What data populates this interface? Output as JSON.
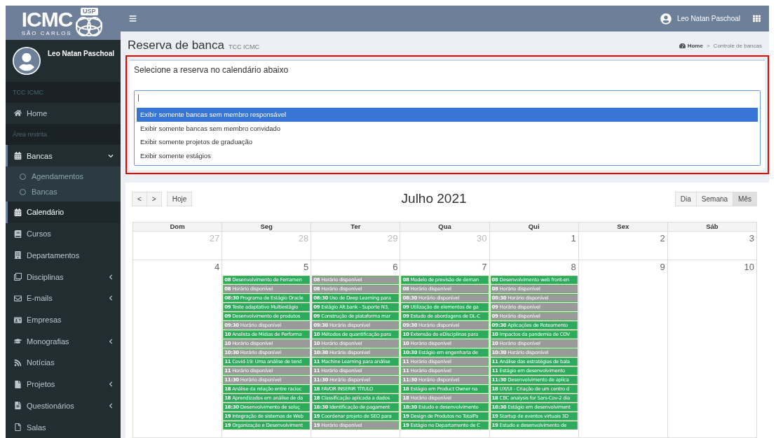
{
  "logo": {
    "title": "ICMC",
    "badge": "USP",
    "subtitle": "SÃO CARLOS"
  },
  "user": {
    "name": "Leo Natan Paschoal"
  },
  "sidebar": {
    "sections": [
      {
        "header": "TCC ICMC",
        "items": [
          {
            "label": "Home",
            "selected": false
          }
        ]
      },
      {
        "header": "Área restrita",
        "items": [
          {
            "label": "Bancas",
            "selected": false,
            "expanded": true,
            "children": [
              {
                "label": "Agendamentos",
                "selected": false
              },
              {
                "label": "Bancas",
                "selected": false
              }
            ]
          },
          {
            "label": "Calendário",
            "selected": true
          },
          {
            "label": "Cursos",
            "selected": false
          },
          {
            "label": "Departamentos",
            "selected": false
          },
          {
            "label": "Disciplinas",
            "selected": false,
            "expanded": false
          },
          {
            "label": "E-mails",
            "selected": false,
            "expanded": false
          },
          {
            "label": "Empresas",
            "selected": false
          },
          {
            "label": "Monografias",
            "selected": false,
            "expanded": false
          },
          {
            "label": "Notícias",
            "selected": false
          },
          {
            "label": "Projetos",
            "selected": false,
            "expanded": false
          },
          {
            "label": "Questionários",
            "selected": false,
            "expanded": false
          },
          {
            "label": "Salas",
            "selected": false
          }
        ]
      }
    ]
  },
  "topbar": {
    "user_name": "Leo Natan Paschoal"
  },
  "page": {
    "title": "Reserva de banca",
    "subtitle": "TCC ICMC",
    "breadcrumb": [
      "Home",
      "Controle de bancas"
    ],
    "breadcrumb_separator": ">"
  },
  "filter": {
    "prompt": "Selecione a reserva no calendário abaixo",
    "value": "|",
    "options": [
      {
        "label": "Exibir somente bancas sem membro responsável",
        "selected": true
      },
      {
        "label": "Exibir somente bancas sem membro convidado",
        "selected": false
      },
      {
        "label": "Exibir somente projetos de graduação",
        "selected": false
      },
      {
        "label": "Exibir somente estágios",
        "selected": false
      }
    ]
  },
  "calendar": {
    "nav": {
      "prev": "<",
      "next": ">",
      "today": "Hoje"
    },
    "title": "Julho 2021",
    "views": [
      {
        "label": "Dia",
        "selected": false
      },
      {
        "label": "Semana",
        "selected": false
      },
      {
        "label": "Mês",
        "selected": true
      }
    ],
    "weekdays": [
      "Dom",
      "Seg",
      "Ter",
      "Qua",
      "Qui",
      "Sex",
      "Sáb"
    ],
    "weeks": [
      [
        {
          "day": "27",
          "other_month": true
        },
        {
          "day": "28",
          "other_month": true
        },
        {
          "day": "29",
          "other_month": true
        },
        {
          "day": "30",
          "other_month": true
        },
        {
          "day": "1",
          "other_month": false
        },
        {
          "day": "2",
          "other_month": false
        },
        {
          "day": "3",
          "other_month": false
        }
      ],
      [
        {
          "day": "4",
          "other_month": false
        },
        {
          "day": "5",
          "other_month": false,
          "events": [
            {
              "time": "08",
              "title": "Desenvolvimento de Ferramen",
              "kind": "booked"
            },
            {
              "time": "08",
              "title": "Horário disponível",
              "kind": "free"
            },
            {
              "time": "08:30",
              "title": "Programa de Estágio Oracle",
              "kind": "booked"
            },
            {
              "time": "09",
              "title": "Teste adaptativo Multiestágio",
              "kind": "booked"
            },
            {
              "time": "09",
              "title": "Desenvolvimento de produtos",
              "kind": "booked"
            },
            {
              "time": "09:30",
              "title": "Horário disponível",
              "kind": "free"
            },
            {
              "time": "10",
              "title": "Analista de Mídias de Performa",
              "kind": "booked"
            },
            {
              "time": "10",
              "title": "Horário disponível",
              "kind": "free"
            },
            {
              "time": "10:30",
              "title": "Horário disponível",
              "kind": "free"
            },
            {
              "time": "11",
              "title": "Covid-19: Uma análise de tend",
              "kind": "booked"
            },
            {
              "time": "11",
              "title": "Horário disponível",
              "kind": "free"
            },
            {
              "time": "11:30",
              "title": "Horário disponível",
              "kind": "free"
            },
            {
              "time": "18",
              "title": "Análise da relação entre racioc",
              "kind": "booked"
            },
            {
              "time": "18",
              "title": "Aprendizados em análise de da",
              "kind": "booked"
            },
            {
              "time": "18:30",
              "title": "Desenvolvimento de soluç",
              "kind": "booked"
            },
            {
              "time": "19",
              "title": "Integração de sistemas de Web",
              "kind": "booked"
            },
            {
              "time": "19",
              "title": "Organização e Desenvolviment",
              "kind": "booked"
            }
          ]
        },
        {
          "day": "6",
          "other_month": false,
          "events": [
            {
              "time": "08",
              "title": "Horário disponível",
              "kind": "free"
            },
            {
              "time": "08",
              "title": "Horário disponível",
              "kind": "free"
            },
            {
              "time": "08:30",
              "title": "Uso de Deep Learning para",
              "kind": "booked"
            },
            {
              "time": "09",
              "title": "Estágio Alt.bank - Suporte N3,",
              "kind": "booked"
            },
            {
              "time": "09",
              "title": "Construção de plataforma mar",
              "kind": "booked"
            },
            {
              "time": "09:30",
              "title": "Horário disponível",
              "kind": "free"
            },
            {
              "time": "10",
              "title": "Métodos de quantificação para",
              "kind": "booked"
            },
            {
              "time": "10",
              "title": "Horário disponível",
              "kind": "free"
            },
            {
              "time": "10:30",
              "title": "Horário disponível",
              "kind": "free"
            },
            {
              "time": "11",
              "title": "Machine Learning para análise",
              "kind": "booked"
            },
            {
              "time": "11",
              "title": "Horário disponível",
              "kind": "free"
            },
            {
              "time": "11:30",
              "title": "Horário disponível",
              "kind": "free"
            },
            {
              "time": "18",
              "title": "FAVOR INSERIR TÍTULO",
              "kind": "booked"
            },
            {
              "time": "18",
              "title": "Classificação aplicada a dados",
              "kind": "booked"
            },
            {
              "time": "18:30",
              "title": "Identificação de pagament",
              "kind": "booked"
            },
            {
              "time": "19",
              "title": "Coordenar projeto de SEO para",
              "kind": "booked"
            },
            {
              "time": "19",
              "title": "Horário disponível",
              "kind": "free"
            }
          ]
        },
        {
          "day": "7",
          "other_month": false,
          "events": [
            {
              "time": "08",
              "title": "Modelo de previsão de deman",
              "kind": "booked"
            },
            {
              "time": "08",
              "title": "Horário disponível",
              "kind": "free"
            },
            {
              "time": "08:30",
              "title": "Horário disponível",
              "kind": "free"
            },
            {
              "time": "09",
              "title": "Utilização de elementos de ga",
              "kind": "booked"
            },
            {
              "time": "09",
              "title": "Estudo de abordagens de DL-C",
              "kind": "booked"
            },
            {
              "time": "09:30",
              "title": "Horário disponível",
              "kind": "free"
            },
            {
              "time": "10",
              "title": "Extensão do eDisciplinas para",
              "kind": "booked"
            },
            {
              "time": "10",
              "title": "Horário disponível",
              "kind": "free"
            },
            {
              "time": "10:30",
              "title": "Estágio em engenharia de",
              "kind": "booked"
            },
            {
              "time": "11",
              "title": "Horário disponível",
              "kind": "free"
            },
            {
              "time": "11",
              "title": "Horário disponível",
              "kind": "free"
            },
            {
              "time": "11:30",
              "title": "Horário disponível",
              "kind": "free"
            },
            {
              "time": "18",
              "title": "Estágio em Product Owner na",
              "kind": "booked"
            },
            {
              "time": "18",
              "title": "Horário disponível",
              "kind": "free"
            },
            {
              "time": "18:30",
              "title": "Estudo e desenvolvimento",
              "kind": "booked"
            },
            {
              "time": "19",
              "title": "Design de Produtos no TotalPa",
              "kind": "booked"
            },
            {
              "time": "19",
              "title": "Estágio no Departamento de C",
              "kind": "booked"
            }
          ]
        },
        {
          "day": "8",
          "other_month": false,
          "events": [
            {
              "time": "08",
              "title": "Desenvolvimento web front-en",
              "kind": "booked"
            },
            {
              "time": "08",
              "title": "Horário disponível",
              "kind": "free"
            },
            {
              "time": "08:30",
              "title": "Horário disponível",
              "kind": "free"
            },
            {
              "time": "09",
              "title": "Horário disponível",
              "kind": "free"
            },
            {
              "time": "09",
              "title": "Horário disponível",
              "kind": "free"
            },
            {
              "time": "09:30",
              "title": "Aplicações de Roteamento",
              "kind": "booked"
            },
            {
              "time": "10",
              "title": "Impactos da pandemia de COV",
              "kind": "booked"
            },
            {
              "time": "10",
              "title": "Horário disponível",
              "kind": "free"
            },
            {
              "time": "10:30",
              "title": "Horário disponível",
              "kind": "free"
            },
            {
              "time": "11",
              "title": "Análise das estratégias de bala",
              "kind": "booked"
            },
            {
              "time": "11",
              "title": "Estágio em desenvolvimento",
              "kind": "booked"
            },
            {
              "time": "11:30",
              "title": "Desenvolvimento de aplica",
              "kind": "booked"
            },
            {
              "time": "18",
              "title": "UX/UI - Criação de um centro d",
              "kind": "booked"
            },
            {
              "time": "18",
              "title": "CBC analysis for Sars-Cov-2 dia",
              "kind": "booked"
            },
            {
              "time": "18:30",
              "title": "Estágio em desenvolviment",
              "kind": "booked"
            },
            {
              "time": "19",
              "title": "Startup de eventos virtuais 3D",
              "kind": "booked"
            },
            {
              "time": "19",
              "title": "Estudo e desenvolvimento de",
              "kind": "booked"
            }
          ]
        },
        {
          "day": "9",
          "other_month": false
        },
        {
          "day": "10",
          "other_month": false
        }
      ]
    ]
  }
}
